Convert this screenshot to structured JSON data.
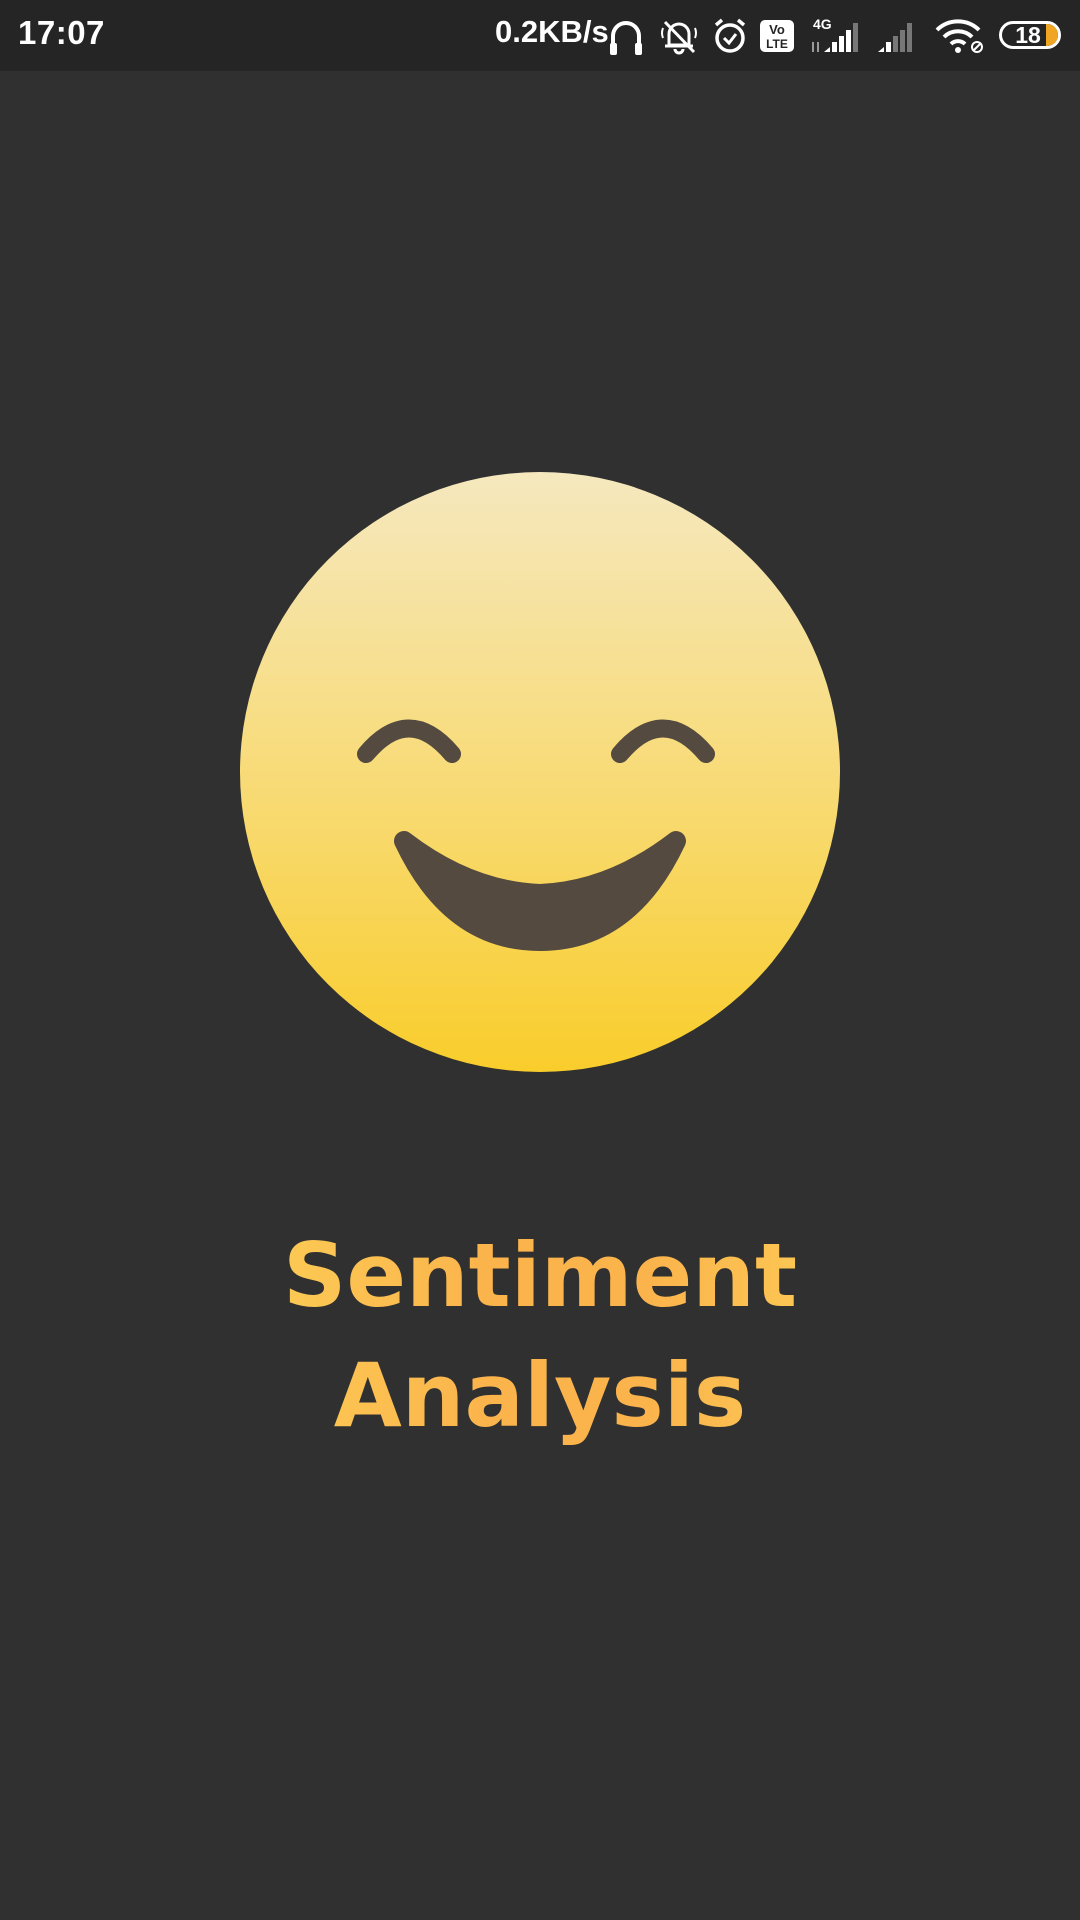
{
  "status_bar": {
    "time": "17:07",
    "network_speed": "0.2KB/s",
    "network_type": "4G",
    "volte_label_top": "Vo",
    "volte_label_bottom": "LTE",
    "battery_level": "18",
    "icons": [
      "headphones-icon",
      "muted-bell-icon",
      "alarm-icon",
      "volte-icon",
      "signal-icon",
      "signal-icon",
      "wifi-icon",
      "battery-icon"
    ]
  },
  "app": {
    "title_line1": "Sentiment",
    "title_line2": "Analysis",
    "title_gradient": [
      "#fde65f",
      "#fbb44c"
    ],
    "face_gradient": [
      "#f5e7bc",
      "#f9cd2b"
    ],
    "face_feature_color": "#544a3f",
    "background_color": "#303030"
  }
}
